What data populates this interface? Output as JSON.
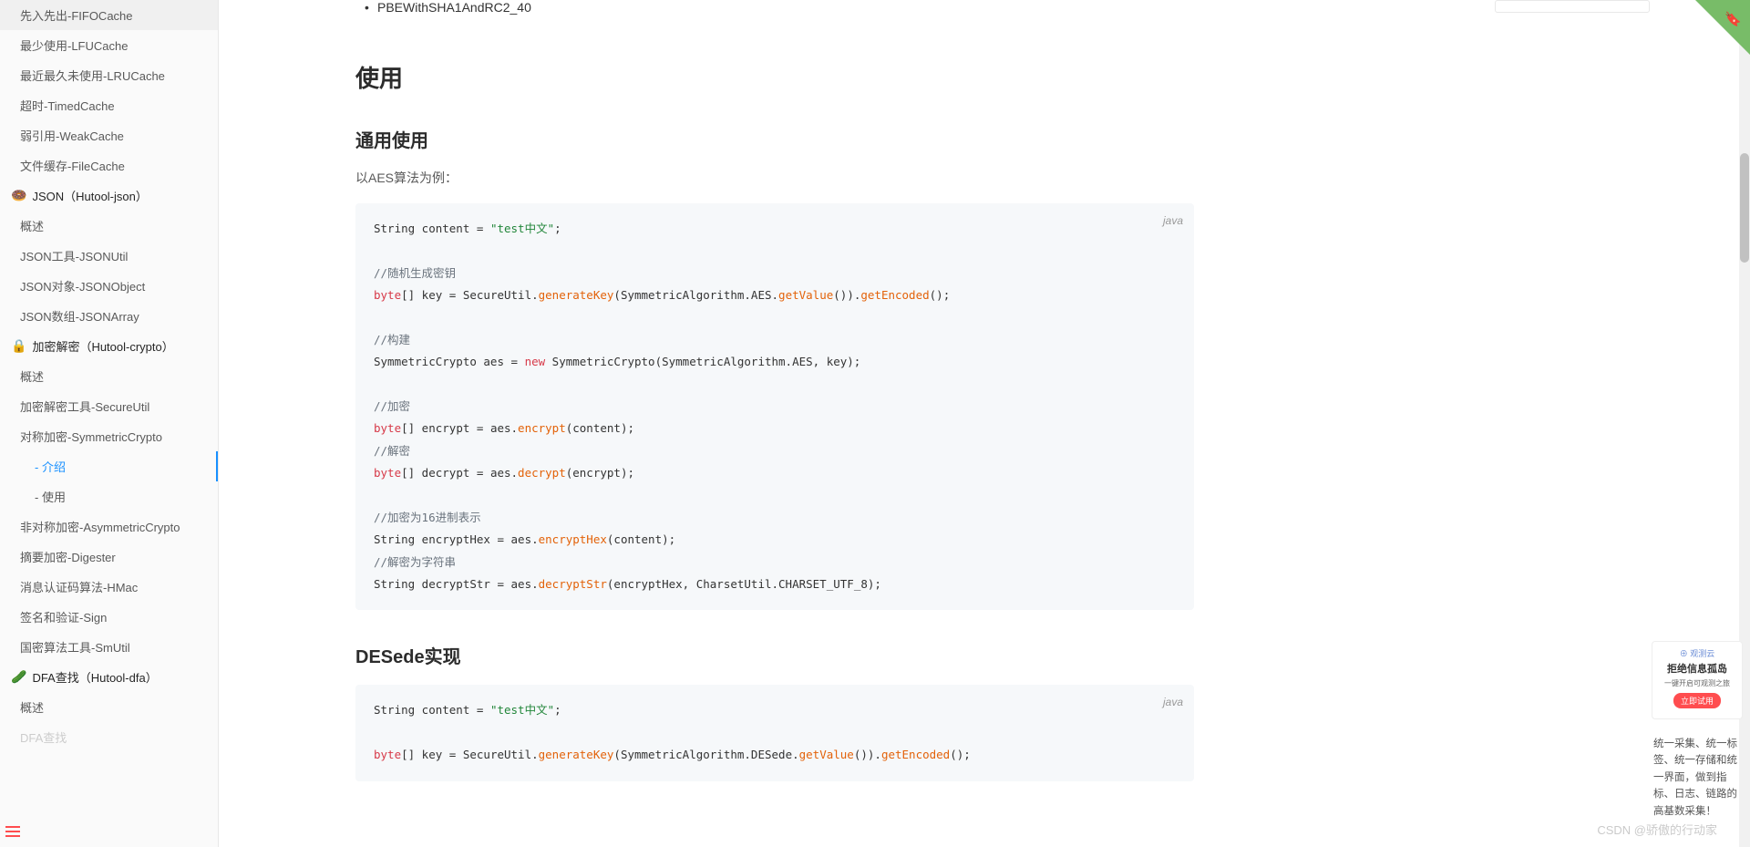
{
  "sidebar": {
    "items": [
      {
        "label": "先入先出-FIFOCache",
        "section": false
      },
      {
        "label": "最少使用-LFUCache",
        "section": false
      },
      {
        "label": "最近最久未使用-LRUCache",
        "section": false
      },
      {
        "label": "超时-TimedCache",
        "section": false
      },
      {
        "label": "弱引用-WeakCache",
        "section": false
      },
      {
        "label": "文件缓存-FileCache",
        "section": false
      },
      {
        "label": "JSON（Hutool-json）",
        "section": true,
        "icon": "🍩"
      },
      {
        "label": "概述",
        "section": false
      },
      {
        "label": "JSON工具-JSONUtil",
        "section": false
      },
      {
        "label": "JSON对象-JSONObject",
        "section": false
      },
      {
        "label": "JSON数组-JSONArray",
        "section": false
      },
      {
        "label": "加密解密（Hutool-crypto）",
        "section": true,
        "icon": "🔒"
      },
      {
        "label": "概述",
        "section": false
      },
      {
        "label": "加密解密工具-SecureUtil",
        "section": false
      },
      {
        "label": "对称加密-SymmetricCrypto",
        "section": false
      },
      {
        "label": "- 介绍",
        "section": false,
        "sub": true,
        "active": true
      },
      {
        "label": "- 使用",
        "section": false,
        "sub": true
      },
      {
        "label": "非对称加密-AsymmetricCrypto",
        "section": false
      },
      {
        "label": "摘要加密-Digester",
        "section": false
      },
      {
        "label": "消息认证码算法-HMac",
        "section": false
      },
      {
        "label": "签名和验证-Sign",
        "section": false
      },
      {
        "label": "国密算法工具-SmUtil",
        "section": false
      },
      {
        "label": "DFA查找（Hutool-dfa）",
        "section": true,
        "icon": "🥒"
      },
      {
        "label": "概述",
        "section": false
      },
      {
        "label": "DFA查找",
        "section": false,
        "faded": true
      }
    ]
  },
  "content": {
    "bullet1": "PBEWithSHA1AndRC2_40",
    "h2_usage": "使用",
    "h3_general": "通用使用",
    "para_aes": "以AES算法为例：",
    "h3_desede": "DESede实现",
    "code_lang": "java",
    "code1": {
      "line1_a": "String content = ",
      "line1_str": "\"test中文\"",
      "line1_b": ";",
      "cmt1": "//随机生成密钥",
      "line2_kw": "byte",
      "line2_a": "[] key = SecureUtil.",
      "line2_fn": "generateKey",
      "line2_b": "(SymmetricAlgorithm.AES.",
      "line2_fn2": "getValue",
      "line2_c": "()).",
      "line2_fn3": "getEncoded",
      "line2_d": "();",
      "cmt2": "//构建",
      "line3_a": "SymmetricCrypto aes = ",
      "line3_kw": "new",
      "line3_b": " SymmetricCrypto(SymmetricAlgorithm.AES, key);",
      "cmt3": "//加密",
      "line4_kw": "byte",
      "line4_a": "[] encrypt = aes.",
      "line4_fn": "encrypt",
      "line4_b": "(content);",
      "cmt4": "//解密",
      "line5_kw": "byte",
      "line5_a": "[] decrypt = aes.",
      "line5_fn": "decrypt",
      "line5_b": "(encrypt);",
      "cmt5": "//加密为16进制表示",
      "line6_a": "String encryptHex = aes.",
      "line6_fn": "encryptHex",
      "line6_b": "(content);",
      "cmt6": "//解密为字符串",
      "line7_a": "String decryptStr = aes.",
      "line7_fn": "decryptStr",
      "line7_b": "(encryptHex, CharsetUtil.CHARSET_UTF_8);"
    },
    "code2": {
      "line1_a": "String content = ",
      "line1_str": "\"test中文\"",
      "line1_b": ";",
      "line2_kw": "byte",
      "line2_a": "[] key = SecureUtil.",
      "line2_fn": "generateKey",
      "line2_b": "(SymmetricAlgorithm.DESede.",
      "line2_fn2": "getValue",
      "line2_c": "()).",
      "line2_fn3": "getEncoded",
      "line2_d": "();"
    }
  },
  "ad": {
    "logo": "⊕ 观测云",
    "title": "拒绝信息孤岛",
    "sub": "一键开启可观测之旅",
    "btn": "立即试用",
    "desc": "统一采集、统一标签、统一存储和统一界面，做到指标、日志、链路的高基数采集！"
  },
  "watermark": "CSDN @骄傲的行动家"
}
